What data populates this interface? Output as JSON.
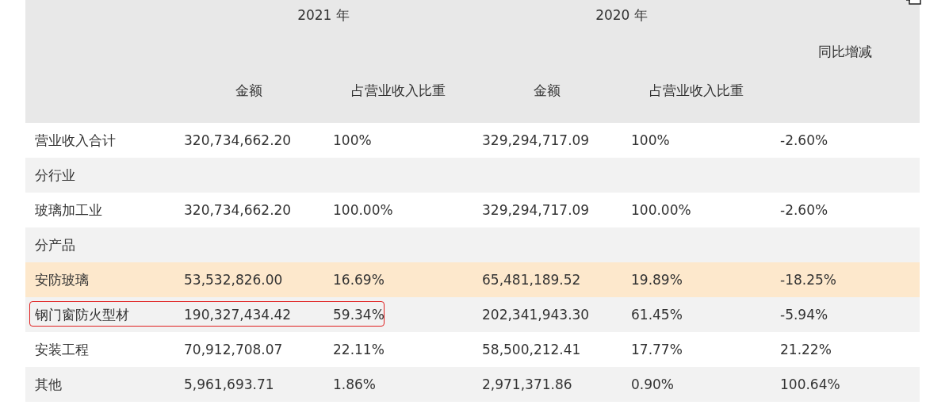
{
  "header": {
    "years": [
      "2021 年",
      "2020 年"
    ],
    "change": "同比增减",
    "subheads": [
      "金额",
      "占营业收入比重",
      "金额",
      "占营业收入比重"
    ]
  },
  "rows": [
    {
      "cells": [
        "营业收入合计",
        "320,734,662.20",
        "100%",
        "329,294,717.09",
        "100%",
        "-2.60%"
      ],
      "highlighted": false,
      "annotated": false
    },
    {
      "cells": [
        "分行业"
      ],
      "highlighted": false,
      "annotated": false
    },
    {
      "cells": [
        "玻璃加工业",
        "320,734,662.20",
        "100.00%",
        "329,294,717.09",
        "100.00%",
        "-2.60%"
      ],
      "highlighted": false,
      "annotated": false
    },
    {
      "cells": [
        "分产品"
      ],
      "highlighted": false,
      "annotated": false
    },
    {
      "cells": [
        "安防玻璃",
        "53,532,826.00",
        "16.69%",
        "65,481,189.52",
        "19.89%",
        "-18.25%"
      ],
      "highlighted": true,
      "annotated": false
    },
    {
      "cells": [
        "钢门窗防火型材",
        "190,327,434.42",
        "59.34%",
        "202,341,943.30",
        "61.45%",
        "-5.94%"
      ],
      "highlighted": false,
      "annotated": true
    },
    {
      "cells": [
        "安装工程",
        "70,912,708.07",
        "22.11%",
        "58,500,212.41",
        "17.77%",
        "21.22%"
      ],
      "highlighted": false,
      "annotated": false
    },
    {
      "cells": [
        "其他",
        "5,961,693.71",
        "1.86%",
        "2,971,371.86",
        "0.90%",
        "100.64%"
      ],
      "highlighted": false,
      "annotated": false
    }
  ]
}
